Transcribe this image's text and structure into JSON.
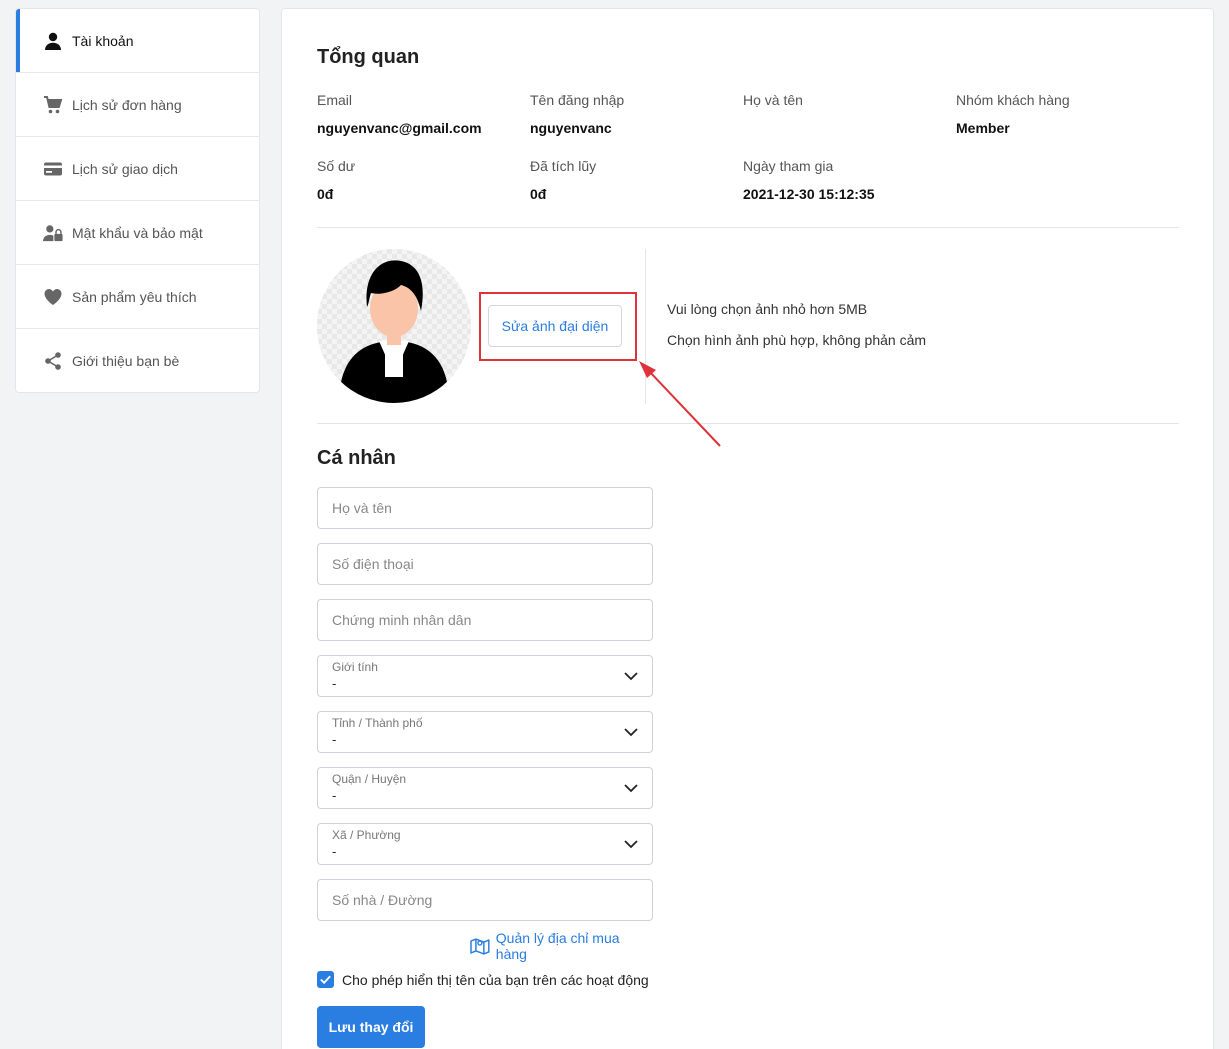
{
  "sidebar": {
    "items": [
      {
        "label": "Tài khoản",
        "icon": "user-icon",
        "active": true
      },
      {
        "label": "Lịch sử đơn hàng",
        "icon": "cart-icon"
      },
      {
        "label": "Lịch sử giao dịch",
        "icon": "credit-card-icon"
      },
      {
        "label": "Mật khẩu và bảo mật",
        "icon": "user-lock-icon"
      },
      {
        "label": "Sản phẩm yêu thích",
        "icon": "heart-icon"
      },
      {
        "label": "Giới thiệu bạn bè",
        "icon": "share-icon"
      }
    ]
  },
  "overview": {
    "title": "Tổng quan",
    "email": {
      "label": "Email",
      "value": "nguyenvanc@gmail.com"
    },
    "username": {
      "label": "Tên đăng nhập",
      "value": "nguyenvanc"
    },
    "fullname": {
      "label": "Họ và tên",
      "value": ""
    },
    "group": {
      "label": "Nhóm khách hàng",
      "value": "Member"
    },
    "balance": {
      "label": "Số dư",
      "value": "0đ"
    },
    "accumulated": {
      "label": "Đã tích lũy",
      "value": "0đ"
    },
    "joined": {
      "label": "Ngày tham gia",
      "value": "2021-12-30 15:12:35"
    }
  },
  "avatar": {
    "edit_label": "Sửa ảnh đại diện",
    "tip1": "Vui lòng chọn ảnh nhỏ hơn 5MB",
    "tip2": "Chọn hình ảnh phù hợp, không phản cảm"
  },
  "personal": {
    "title": "Cá nhân",
    "fullname_placeholder": "Họ và tên",
    "phone_placeholder": "Số điện thoại",
    "id_placeholder": "Chứng minh nhân dân",
    "gender": {
      "label": "Giới tính",
      "value": "-"
    },
    "province": {
      "label": "Tỉnh / Thành phố",
      "value": "-"
    },
    "district": {
      "label": "Quận / Huyện",
      "value": "-"
    },
    "ward": {
      "label": "Xã / Phường",
      "value": "-"
    },
    "street_placeholder": "Số nhà / Đường",
    "address_link": "Quản lý địa chỉ mua hàng",
    "show_name_label": "Cho phép hiển thị tên của bạn trên các hoạt động",
    "show_name_checked": true,
    "save_label": "Lưu thay đổi"
  },
  "colors": {
    "accent": "#2a7de1",
    "highlight": "#e0323a"
  }
}
